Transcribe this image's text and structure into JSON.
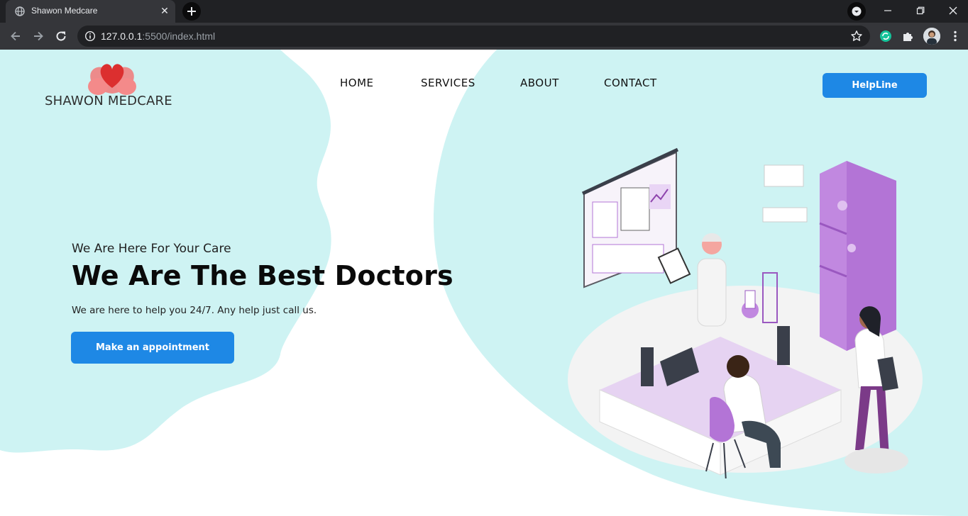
{
  "browser": {
    "tab_title": "Shawon Medcare",
    "url_host": "127.0.0.1",
    "url_rest": ":5500/index.html",
    "icons": [
      "globe-icon",
      "close-icon",
      "plus-icon",
      "chevron-down-icon",
      "minimize-icon",
      "restore-icon",
      "window-close-icon",
      "back-icon",
      "forward-icon",
      "reload-icon",
      "info-icon",
      "star-icon",
      "extension-sync-icon",
      "puzzle-icon",
      "avatar",
      "kebab-menu-icon"
    ]
  },
  "site": {
    "logo_text": "SHAWON MEDCARE",
    "nav": [
      "HOME",
      "SERVICES",
      "ABOUT",
      "CONTACT"
    ],
    "helpline_label": "HelpLine",
    "hero": {
      "subtitle": "We Are Here For Your Care",
      "title": "We Are The Best Doctors",
      "description": "We are here to help you 24/7. Any help just call us.",
      "cta_label": "Make an appointment"
    },
    "colors": {
      "accent": "#1e88e5",
      "background_blob": "#cef3f3",
      "logo_heart": "#e53935",
      "illustration_purple": "#b374d6"
    }
  }
}
